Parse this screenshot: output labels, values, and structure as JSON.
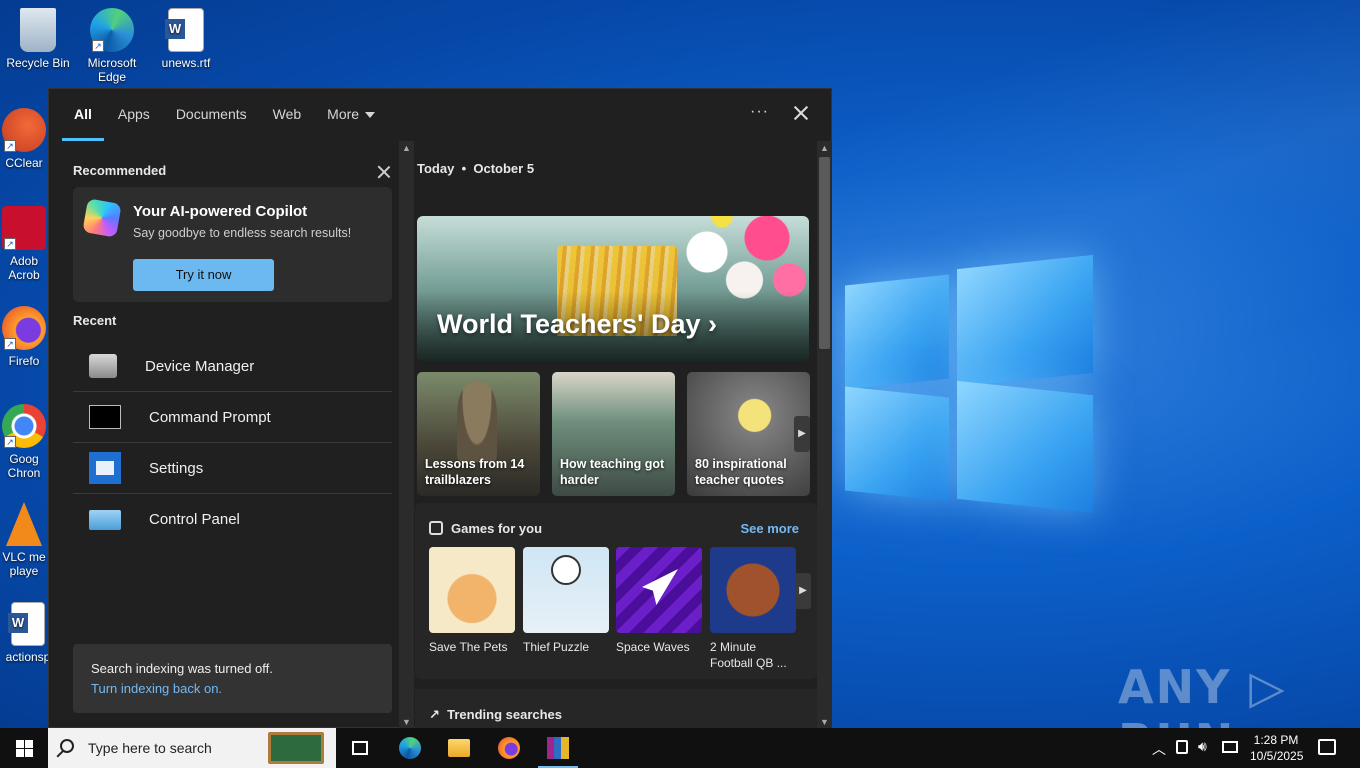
{
  "desktop": {
    "icons": [
      {
        "label": "Recycle Bin",
        "icon": "recycle-bin-icon"
      },
      {
        "label": "Microsoft Edge",
        "icon": "edge-icon"
      },
      {
        "label": "unews.rtf",
        "icon": "word-document-icon"
      },
      {
        "label": "CClear",
        "icon": "ccleaner-icon"
      },
      {
        "label": "Adob Acrob",
        "icon": "adobe-acrobat-icon"
      },
      {
        "label": "Firefo",
        "icon": "firefox-icon"
      },
      {
        "label": "Goog Chron",
        "icon": "chrome-icon"
      },
      {
        "label": "VLC me playe",
        "icon": "vlc-icon"
      },
      {
        "label": "actionsp",
        "icon": "word-document-icon"
      }
    ],
    "watermark": "ANY ▷ RUN"
  },
  "search_panel": {
    "tabs": [
      {
        "label": "All",
        "active": true
      },
      {
        "label": "Apps"
      },
      {
        "label": "Documents"
      },
      {
        "label": "Web"
      },
      {
        "label": "More"
      }
    ],
    "more_options_label": "···",
    "recommended": {
      "title": "Recommended",
      "copilot": {
        "title": "Your AI-powered Copilot",
        "subtitle": "Say goodbye to endless search results!",
        "button": "Try it now"
      }
    },
    "recent": {
      "title": "Recent",
      "items": [
        {
          "label": "Device Manager",
          "icon": "device-manager-icon"
        },
        {
          "label": "Command Prompt",
          "icon": "command-prompt-icon"
        },
        {
          "label": "Settings",
          "icon": "settings-icon"
        },
        {
          "label": "Control Panel",
          "icon": "control-panel-icon"
        }
      ]
    },
    "indexing": {
      "message": "Search indexing was turned off.",
      "link": "Turn indexing back on."
    },
    "today": {
      "day": "Today",
      "separator": "•",
      "date": "October 5",
      "hero_title": "World Teachers' Day",
      "cards": [
        {
          "caption": "Lessons from 14 trailblazers"
        },
        {
          "caption": "How teaching got harder"
        },
        {
          "caption": "80 inspirational teacher quotes"
        }
      ]
    },
    "games": {
      "title": "Games for you",
      "see_more": "See more",
      "items": [
        {
          "name": "Save The Pets"
        },
        {
          "name": "Thief Puzzle"
        },
        {
          "name": "Space Waves"
        },
        {
          "name": "2 Minute Football QB ..."
        }
      ]
    },
    "trending": {
      "title": "Trending searches"
    }
  },
  "taskbar": {
    "search_placeholder": "Type here to search",
    "apps": [
      "task-view-icon",
      "edge-icon",
      "file-explorer-icon",
      "firefox-icon",
      "winrar-icon"
    ],
    "clock": {
      "time": "1:28 PM",
      "date": "10/5/2025"
    }
  }
}
